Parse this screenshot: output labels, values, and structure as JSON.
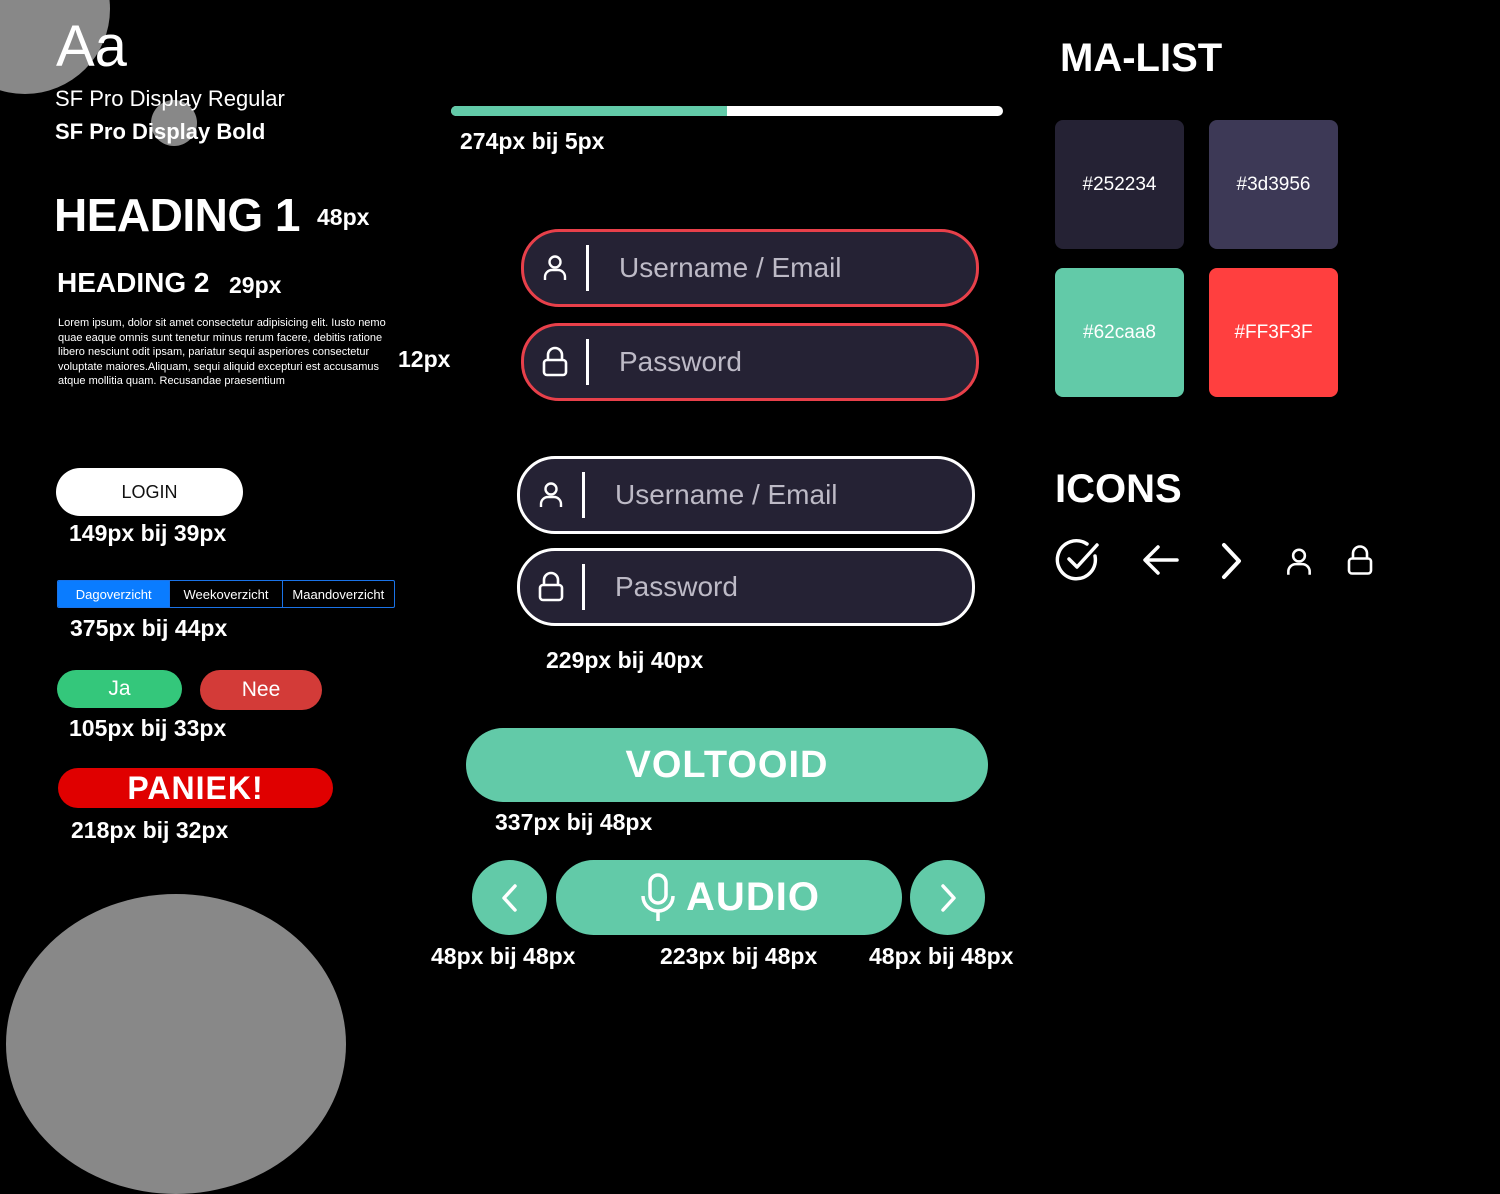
{
  "typography": {
    "sample": "Aa",
    "font_regular": "SF Pro Display Regular",
    "font_bold": "SF Pro Display Bold",
    "heading1": "HEADING 1",
    "heading1_size": "48px",
    "heading2": "HEADING 2",
    "heading2_size": "29px",
    "body_text": "Lorem ipsum, dolor sit amet consectetur adipisicing elit. Iusto nemo quae eaque omnis sunt tenetur minus rerum facere, debitis ratione libero nesciunt odit ipsam, pariatur sequi asperiores consectetur voluptate maiores.Aliquam, sequi aliquid excepturi est accusamus atque mollitia quam. Recusandae praesentium",
    "body_size": "12px"
  },
  "progress": {
    "value": 0.5,
    "size_label": "274px bij 5px",
    "fill_color": "#62caa8"
  },
  "buttons": {
    "login": "LOGIN",
    "login_size": "149px bij 39px",
    "segments": [
      "Dagoverzicht",
      "Weekoverzicht",
      "Maandoverzicht"
    ],
    "segment_selected": "Dagoverzicht",
    "segments_size": "375px bij 44px",
    "ja": "Ja",
    "nee": "Nee",
    "janee_size": "105px bij 33px",
    "paniek": "PANIEK!",
    "paniek_size": "218px bij 32px",
    "voltooid": "VOLTOOID",
    "voltooid_size": "337px bij 48px",
    "audio": "AUDIO",
    "prev_size": "48px bij 48px",
    "audio_size": "223px bij 48px",
    "next_size": "48px bij 48px"
  },
  "inputs": {
    "username_placeholder": "Username / Email",
    "password_placeholder": "Password",
    "size_label": "229px bij 40px",
    "error_border_color": "#e8404a"
  },
  "palette": {
    "title": "MA-LIST",
    "swatches": [
      {
        "label": "#252234",
        "color": "#252234"
      },
      {
        "label": "#3d3956",
        "color": "#3d3956"
      },
      {
        "label": "#62caa8",
        "color": "#62caa8"
      },
      {
        "label": "#FF3F3F",
        "color": "#FF3F3F"
      }
    ]
  },
  "icons": {
    "title": "ICONS",
    "items": [
      "check-circle-icon",
      "arrow-left-icon",
      "chevron-right-icon",
      "user-icon",
      "lock-icon"
    ]
  }
}
